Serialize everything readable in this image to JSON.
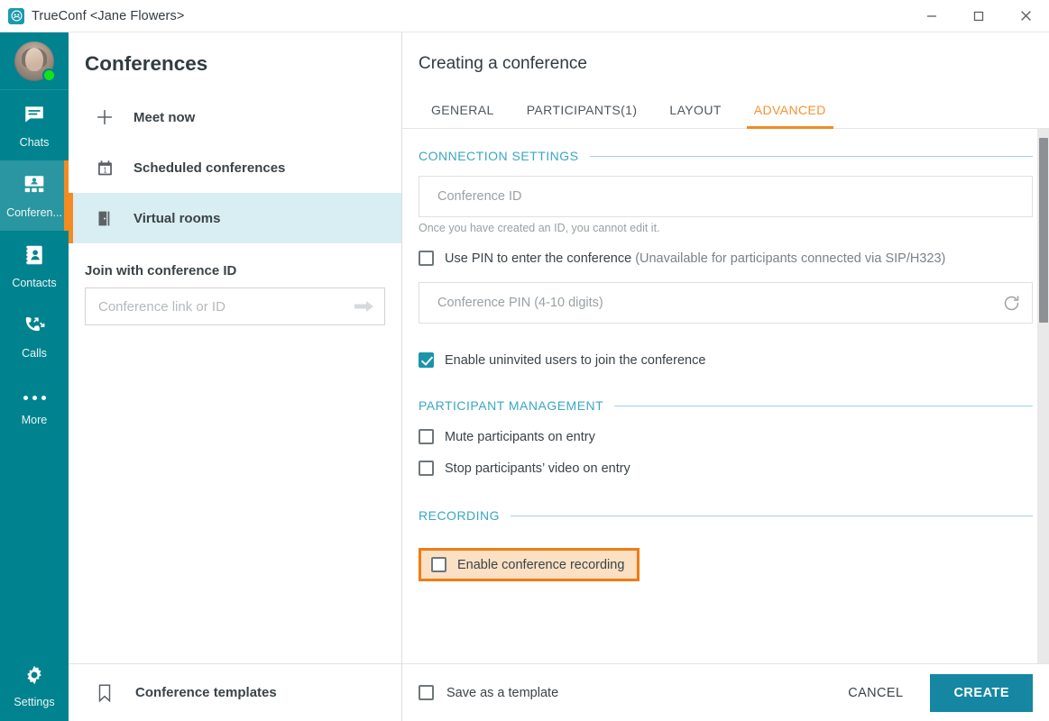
{
  "window": {
    "title": "TrueConf <Jane Flowers>",
    "app_icon": "trueconf-logo-icon",
    "minimize": "–",
    "maximize": "□",
    "close": "✕"
  },
  "colors": {
    "rail_teal": "#00838f",
    "rail_active_teal": "#2a96a1",
    "accent_orange": "#f28b22",
    "section_blue": "#3aa7c4",
    "create_button": "#1587a3",
    "checkbox_checked": "#1995ab",
    "selected_row": "#d9eef2",
    "highlight_fill": "#fce0c4",
    "highlight_border": "#f07c14",
    "presence_online": "#16e216"
  },
  "rail": {
    "avatar_name": "Jane Flowers",
    "presence": "online",
    "items": [
      {
        "label": "Chats",
        "icon": "chat-bubble-icon",
        "active": false
      },
      {
        "label": "Conferen...",
        "icon": "conference-grid-icon",
        "active": true
      },
      {
        "label": "Contacts",
        "icon": "address-book-icon",
        "active": false
      },
      {
        "label": "Calls",
        "icon": "phone-arrows-icon",
        "active": false
      },
      {
        "label": "More",
        "icon": "ellipsis-icon",
        "active": false
      }
    ],
    "settings": {
      "label": "Settings",
      "icon": "gear-icon"
    }
  },
  "middle": {
    "title": "Conferences",
    "menu": [
      {
        "label": "Meet now",
        "icon": "plus-icon",
        "selected": false
      },
      {
        "label": "Scheduled conferences",
        "icon": "calendar-icon",
        "selected": false
      },
      {
        "label": "Virtual rooms",
        "icon": "door-icon",
        "selected": true
      }
    ],
    "join": {
      "label": "Join with conference ID",
      "placeholder": "Conference link or ID",
      "value": "",
      "submit_icon": "arrow-right-icon"
    },
    "footer": {
      "label": "Conference templates",
      "icon": "bookmark-icon"
    }
  },
  "right": {
    "title": "Creating a conference",
    "tabs": [
      {
        "label": "GENERAL",
        "active": false
      },
      {
        "label": "PARTICIPANTS(1)",
        "active": false
      },
      {
        "label": "LAYOUT",
        "active": false
      },
      {
        "label": "ADVANCED",
        "active": true
      }
    ],
    "sections": {
      "connection": {
        "title": "CONNECTION SETTINGS",
        "conference_id": {
          "placeholder": "Conference ID",
          "value": "",
          "hint": "Once you have created an ID, you cannot edit it."
        },
        "use_pin": {
          "label": "Use PIN to enter the conference",
          "note": "(Unavailable for participants connected via SIP/H323)",
          "checked": false
        },
        "pin_field": {
          "placeholder": "Conference PIN (4-10 digits)",
          "value": "",
          "refresh_icon": "refresh-icon"
        },
        "uninvited": {
          "label": "Enable uninvited users to join the conference",
          "checked": true
        }
      },
      "participant_management": {
        "title": "PARTICIPANT MANAGEMENT",
        "options": [
          {
            "label": "Mute participants on entry",
            "checked": false
          },
          {
            "label": "Stop participants’ video on entry",
            "checked": false
          }
        ]
      },
      "recording": {
        "title": "RECORDING",
        "option": {
          "label": "Enable conference recording",
          "checked": false,
          "highlighted": true
        }
      }
    },
    "footer": {
      "save_template": {
        "label": "Save as a template",
        "checked": false
      },
      "cancel_label": "CANCEL",
      "create_label": "CREATE"
    }
  }
}
